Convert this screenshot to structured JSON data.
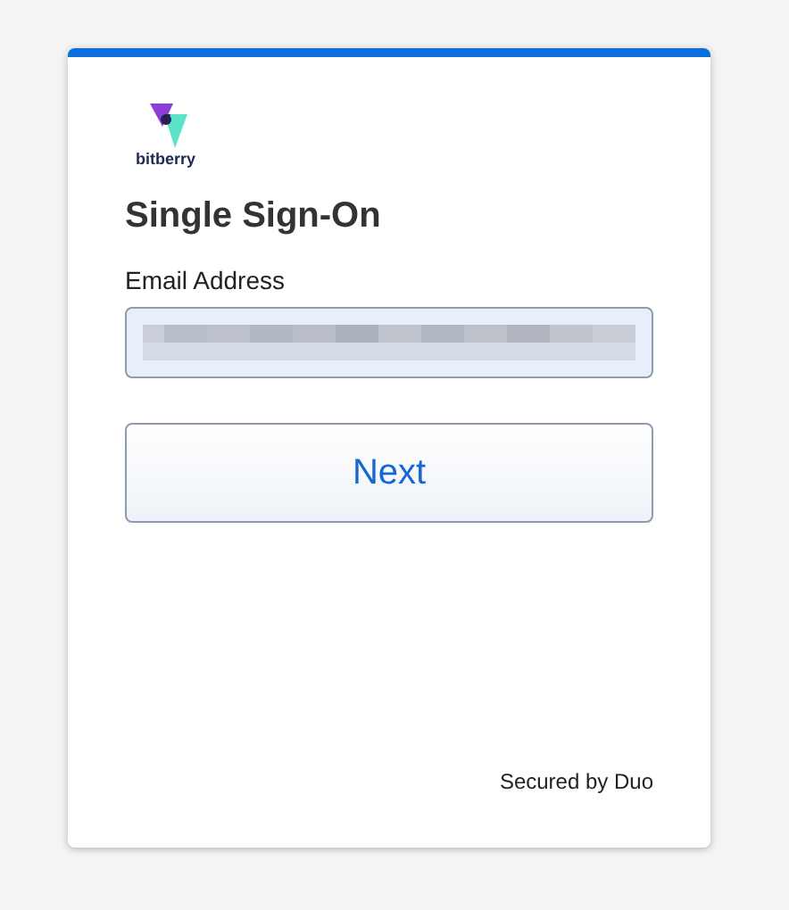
{
  "logo": {
    "text": "bitberry"
  },
  "title": "Single Sign-On",
  "email_field": {
    "label": "Email Address",
    "value_redacted": true
  },
  "next_button": {
    "label": "Next"
  },
  "footer": "Secured by Duo"
}
